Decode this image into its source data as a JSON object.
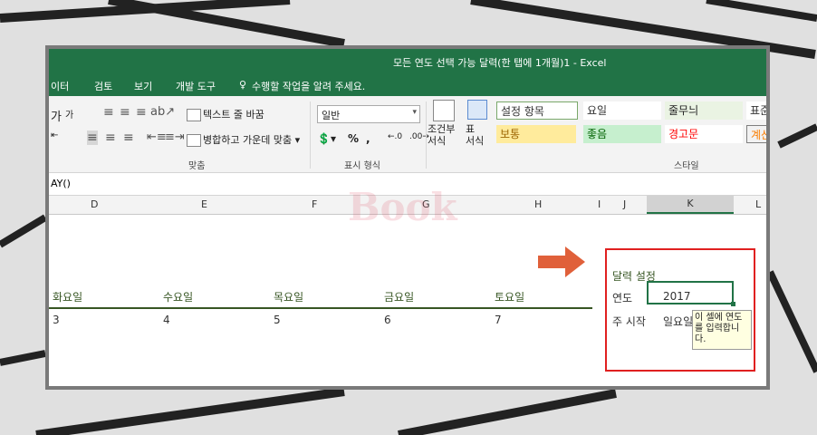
{
  "window": {
    "title": "모든 연도 선택 가능 달력(한 탭에 1개월)1 - Excel"
  },
  "menu": {
    "items": [
      "이터",
      "검토",
      "보기",
      "개발 도구"
    ],
    "tell_me": "수행할 작업을 알려 주세요."
  },
  "ribbon": {
    "font": {
      "btn": "가"
    },
    "wrap_text": "텍스트 줄 바꿈",
    "merge_center": "병합하고 가운데 맞춤",
    "number_format": "일반",
    "percent": "%",
    "comma": ",",
    "conditional_format": "조건부\n서식",
    "table_format": "표\n서식",
    "styles": {
      "s1": "설정 항목",
      "s2": "요일",
      "s3": "줄무늬",
      "s4": "표준",
      "s5": "보통",
      "s6": "좋음",
      "s7": "경고문",
      "s8": "계산"
    },
    "groups": {
      "alignment": "맞춤",
      "number": "표시 형식",
      "styles": "스타일"
    }
  },
  "formula": {
    "text": "AY()"
  },
  "columns": [
    "D",
    "E",
    "F",
    "G",
    "H",
    "I",
    "J",
    "K",
    "L"
  ],
  "days": {
    "headers": [
      "화요일",
      "수요일",
      "목요일",
      "금요일",
      "토요일"
    ],
    "values": [
      "3",
      "4",
      "5",
      "6",
      "7"
    ]
  },
  "settings": {
    "title": "달력 설정",
    "year_label": "연도",
    "year_value": "2017",
    "start_label": "주 시작",
    "start_value": "일요일"
  },
  "tooltip": {
    "text": "이 셀에 연도를 입력합니다."
  },
  "watermark": {
    "text": "Book"
  },
  "colors": {
    "excel_green": "#217346",
    "highlight_red": "#e02020",
    "arrow": "#e0603a"
  }
}
